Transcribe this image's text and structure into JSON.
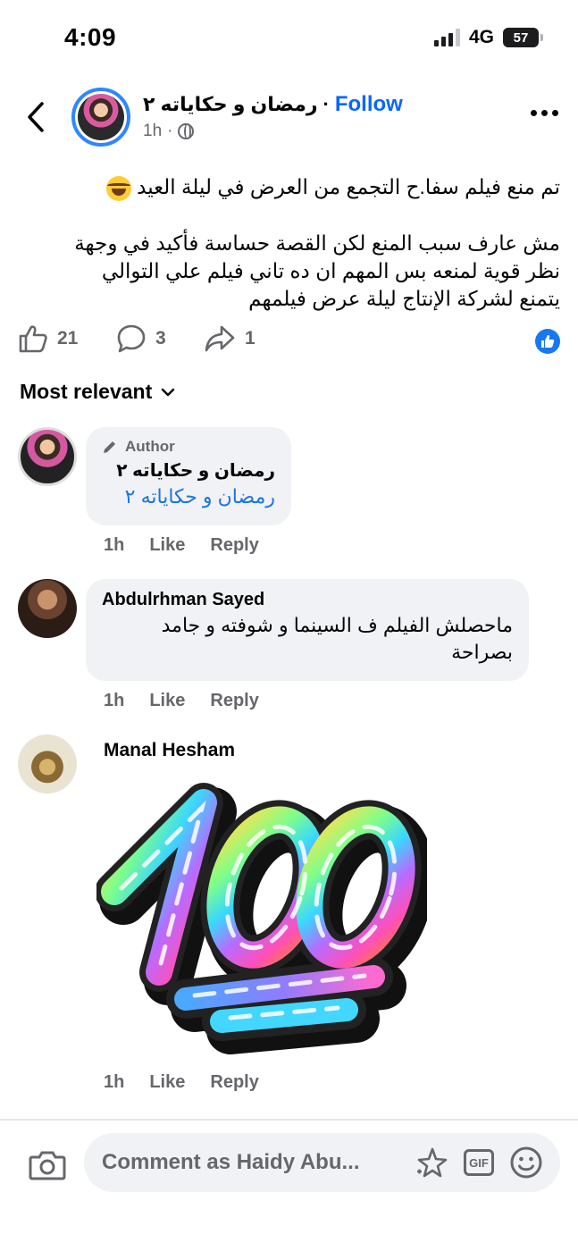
{
  "status_bar": {
    "time": "4:09",
    "network": "4G",
    "battery": "57"
  },
  "post": {
    "page_name": "رمضان و حكاياته ٢",
    "follow_label": "Follow",
    "time": "1h",
    "headline": "تم منع فيلم سفا.ح التجمع من العرض في ليلة العيد",
    "body_lines": [
      "مش عارف سبب المنع لكن القصة حساسة فأكيد في وجهة",
      "نظر قوية لمنعه بس المهم ان ده تاني فيلم علي التوالي",
      "يتمنع لشركة الإنتاج ليلة عرض فيلمهم"
    ],
    "like_count": "21",
    "comment_count": "3",
    "share_count": "1"
  },
  "sort": {
    "label": "Most relevant"
  },
  "comments": [
    {
      "badge": "Author",
      "name": "رمضان و حكاياته ٢",
      "text": "رمضان و حكاياته ٢",
      "time": "1h",
      "like": "Like",
      "reply": "Reply"
    },
    {
      "name": "Abdulrhman Sayed",
      "text_lines": [
        "ماحصلش الفيلم ف السينما و شوفته و جامد",
        "بصراحة"
      ],
      "time": "1h",
      "like": "Like",
      "reply": "Reply"
    },
    {
      "name": "Manal Hesham",
      "sticker": "hundred-points-sticker",
      "time": "1h",
      "like": "Like",
      "reply": "Reply"
    }
  ],
  "composer": {
    "placeholder": "Comment as Haidy Abu...",
    "gif_label": "GIF"
  },
  "colors": {
    "accent": "#0866ff",
    "bubble": "#f0f2f5",
    "muted": "#65676b"
  }
}
